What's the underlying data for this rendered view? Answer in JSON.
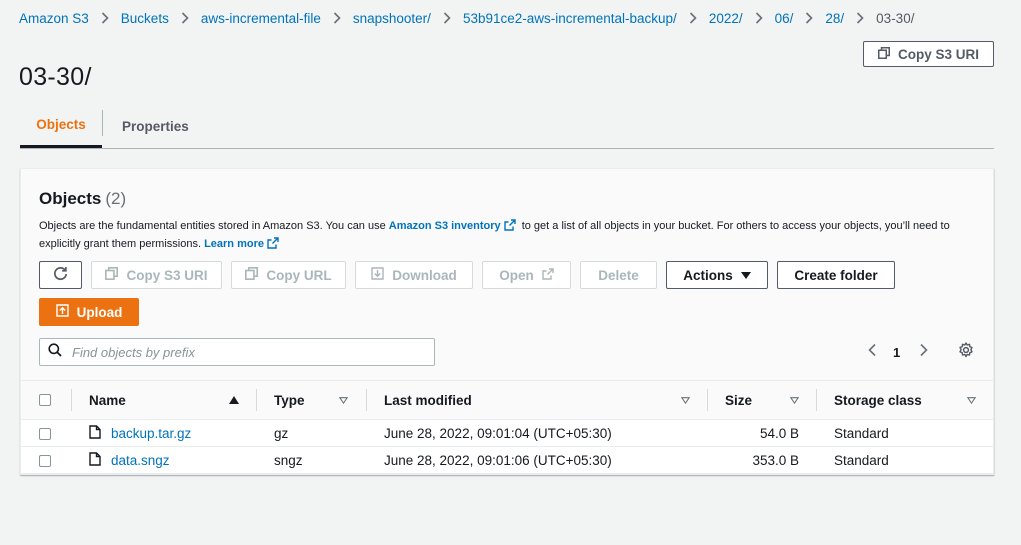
{
  "breadcrumb": {
    "items": [
      "Amazon S3",
      "Buckets",
      "aws-incremental-file",
      "snapshooter/",
      "53b91ce2-aws-incremental-backup/",
      "2022/",
      "06/",
      "28/"
    ],
    "current": "03-30/"
  },
  "page": {
    "title": "03-30/",
    "copy_s3_uri_label": "Copy S3 URI"
  },
  "tabs": [
    {
      "label": "Objects",
      "active": true
    },
    {
      "label": "Properties",
      "active": false
    }
  ],
  "objects_panel": {
    "title": "Objects",
    "count": "(2)",
    "description_1": "Objects are the fundamental entities stored in Amazon S3. You can use ",
    "inventory_link": "Amazon S3 inventory",
    "description_2": " to get a list of all objects in your bucket. For others to access your objects, you’ll need to explicitly grant them permissions. ",
    "learn_more": "Learn more"
  },
  "toolbar": {
    "copy_s3_uri": "Copy S3 URI",
    "copy_url": "Copy URL",
    "download": "Download",
    "open": "Open",
    "delete": "Delete",
    "actions": "Actions",
    "create_folder": "Create folder",
    "upload": "Upload"
  },
  "search": {
    "placeholder": "Find objects by prefix",
    "value": ""
  },
  "pagination": {
    "current_page": "1"
  },
  "table": {
    "headers": {
      "name": "Name",
      "type": "Type",
      "last_modified": "Last modified",
      "size": "Size",
      "storage_class": "Storage class"
    },
    "rows": [
      {
        "name": "backup.tar.gz",
        "type": "gz",
        "last_modified": "June 28, 2022, 09:01:04 (UTC+05:30)",
        "size": "54.0 B",
        "storage_class": "Standard"
      },
      {
        "name": "data.sngz",
        "type": "sngz",
        "last_modified": "June 28, 2022, 09:01:06 (UTC+05:30)",
        "size": "353.0 B",
        "storage_class": "Standard"
      }
    ]
  },
  "colors": {
    "link": "#0073bb",
    "accent_orange": "#ec7211",
    "text": "#16191f",
    "muted": "#545b64",
    "background": "#f2f3f3"
  }
}
